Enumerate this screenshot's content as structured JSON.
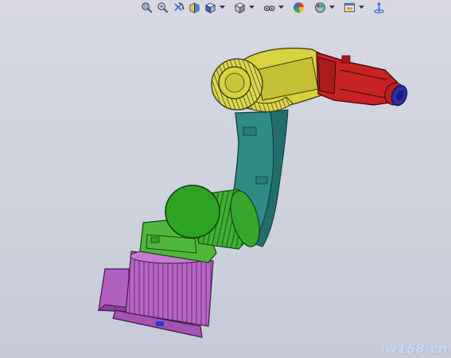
{
  "toolbar": {
    "buttons": [
      {
        "name": "zoom-to-fit",
        "icon": "zoom-to-fit-icon",
        "has_menu": false
      },
      {
        "name": "zoom-to-area",
        "icon": "zoom-to-area-icon",
        "has_menu": false
      },
      {
        "name": "previous-view",
        "icon": "previous-view-icon",
        "has_menu": false
      },
      {
        "name": "section-view",
        "icon": "section-view-icon",
        "has_menu": false
      },
      {
        "name": "view-orientation",
        "icon": "view-orientation-icon",
        "has_menu": true
      },
      {
        "name": "display-style",
        "icon": "display-style-icon",
        "has_menu": true
      },
      {
        "name": "hide-show-items",
        "icon": "hide-show-icon",
        "has_menu": true
      },
      {
        "name": "edit-appearance",
        "icon": "appearance-icon",
        "has_menu": false
      },
      {
        "name": "apply-scene",
        "icon": "scene-icon",
        "has_menu": true
      },
      {
        "name": "view-settings",
        "icon": "view-settings-icon",
        "has_menu": true
      },
      {
        "name": "triad",
        "icon": "triad-icon",
        "has_menu": false
      }
    ]
  },
  "model": {
    "description_colors": {
      "base": "#b15fc0",
      "waist": "#4fb83c",
      "motor": "#2ea222",
      "lower_arm": "#2f8b86",
      "upper_arm": "#d8d23f",
      "forearm": "#c62222",
      "flange": "#2d2fa8"
    }
  },
  "watermark": "iw168.cn"
}
